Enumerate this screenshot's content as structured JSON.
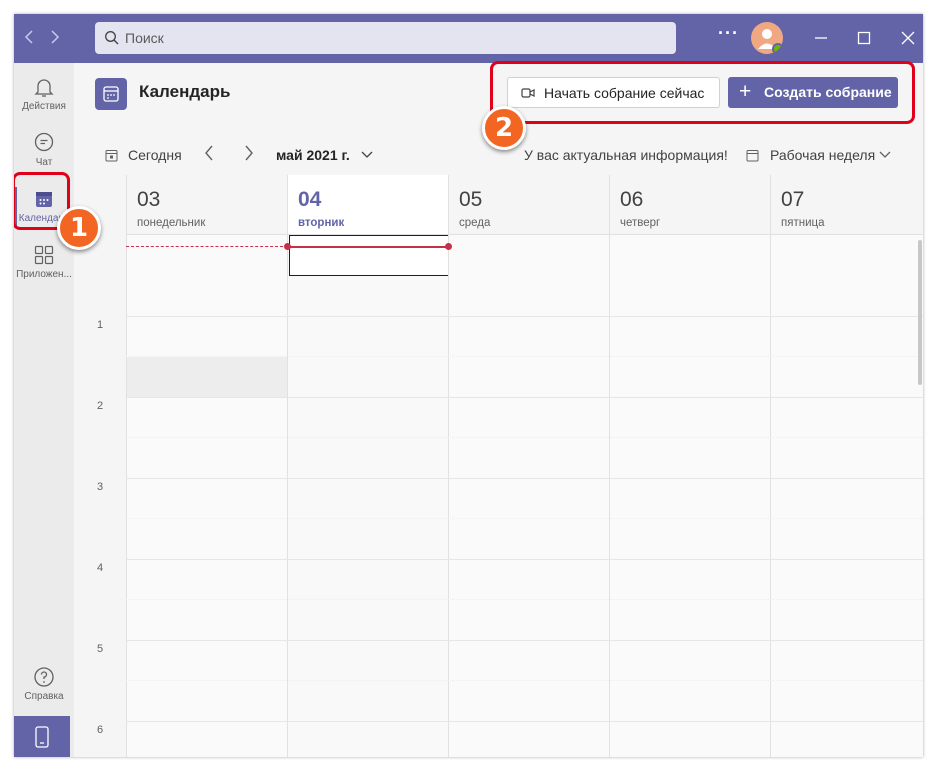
{
  "titlebar": {
    "back_icon": "chevron-left-icon",
    "forward_icon": "chevron-right-icon",
    "search_placeholder": "Поиск",
    "more_label": "···",
    "window_controls": [
      "minimize-icon",
      "maximize-icon",
      "close-icon"
    ]
  },
  "rail": {
    "items": [
      {
        "label": "Действия",
        "icon": "bell-icon"
      },
      {
        "label": "Чат",
        "icon": "chat-icon"
      },
      {
        "label": "Календарь",
        "icon": "calendar-icon",
        "active": true
      },
      {
        "label": "Приложен...",
        "icon": "apps-icon"
      },
      {
        "label": "Справка",
        "icon": "help-icon"
      }
    ],
    "mobile_icon": "mobile-phone-icon"
  },
  "header": {
    "title": "Календарь",
    "meet_now_label": "Начать собрание сейчас",
    "new_meeting_label": "Создать собрание"
  },
  "toolbar": {
    "today_label": "Сегодня",
    "month_label": "май 2021 г.",
    "info_text": "У вас актуальная информация!",
    "view_label": "Рабочая неделя"
  },
  "calendar": {
    "days": [
      {
        "num": "03",
        "name": "понедельник"
      },
      {
        "num": "04",
        "name": "вторник",
        "today": true
      },
      {
        "num": "05",
        "name": "среда"
      },
      {
        "num": "06",
        "name": "четверг"
      },
      {
        "num": "07",
        "name": "пятница"
      }
    ],
    "hours": [
      "1",
      "2",
      "3",
      "4",
      "5",
      "6"
    ]
  },
  "annotations": {
    "badge_1": "1",
    "badge_2": "2"
  },
  "colors": {
    "accent": "#6264a7",
    "highlight": "#e0001a",
    "badge": "#f26522",
    "now_line": "#c4314b"
  }
}
